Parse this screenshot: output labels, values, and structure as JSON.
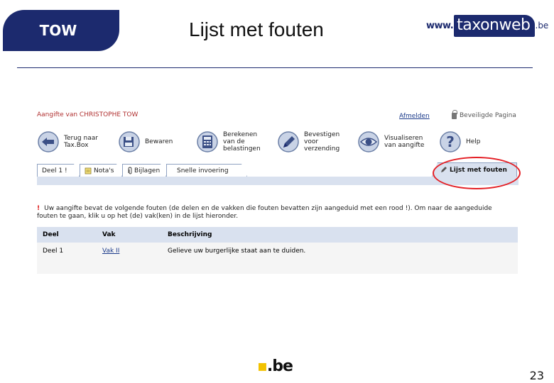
{
  "slide": {
    "badge": "TOW",
    "title": "Lijst met fouten",
    "logo": {
      "www": "www.",
      "name": "taxonweb",
      "tld": ".be"
    },
    "footer_logo": ".be",
    "page_number": "23"
  },
  "app": {
    "greeting": "Aangifte van CHRISTOPHE TOW",
    "logout": "Afmelden",
    "secure": "Beveiligde Pagina",
    "toolbar": [
      {
        "label": "Terug naar\nTax.Box",
        "icon": "back-arrow-icon"
      },
      {
        "label": "Bewaren",
        "icon": "save-icon"
      },
      {
        "label": "Berekenen\nvan de\nbelastingen",
        "icon": "calculator-icon"
      },
      {
        "label": "Bevestigen\nvoor\nverzending",
        "icon": "pen-sign-icon"
      },
      {
        "label": "Visualiseren\nvan aangifte",
        "icon": "eye-icon"
      },
      {
        "label": "Help",
        "icon": "help-icon"
      }
    ],
    "tabs": {
      "deel1": "Deel 1 !",
      "notas": "Nota's",
      "bijlagen": "Bijlagen",
      "snelle": "Snelle invoering",
      "errors": "Lijst met fouten"
    },
    "error_message": "Uw aangifte bevat de volgende fouten (de delen en de vakken die fouten bevatten zijn aangeduid met een rood !). Om naar de aangeduide fouten te gaan, klik u op het (de) vak(ken) in de lijst hieronder.",
    "error_mark": "!",
    "table": {
      "headers": [
        "Deel",
        "Vak",
        "Beschrijving"
      ],
      "rows": [
        {
          "deel": "Deel 1",
          "vak": "Vak II",
          "beschrijving": "Gelieve uw burgerlijke staat aan te duiden."
        }
      ]
    },
    "colors": {
      "navy": "#1c2a6e",
      "highlight": "#e41f25",
      "tab_bg": "#d9e1ef"
    }
  }
}
